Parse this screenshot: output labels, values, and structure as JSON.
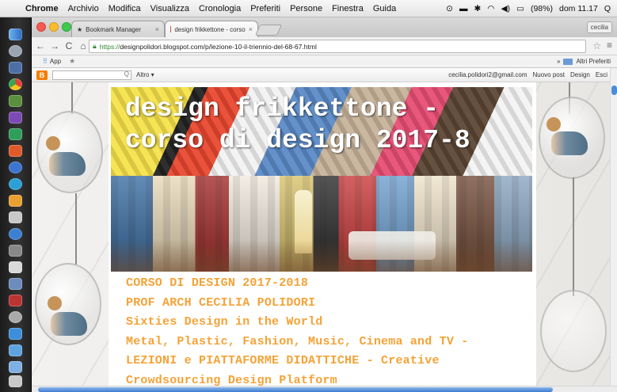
{
  "menubar": {
    "app": "Chrome",
    "items": [
      "Archivio",
      "Modifica",
      "Visualizza",
      "Cronologia",
      "Preferiti",
      "Persone",
      "Finestra",
      "Guida"
    ],
    "battery": "(98%)",
    "clock": "dom 11.17",
    "search_icon": "Q"
  },
  "tabs": [
    {
      "label": "Bookmark Manager",
      "active": false,
      "icon": "star-icon"
    },
    {
      "label": "design frikkettone - corso",
      "active": true,
      "icon": "blog-favicon"
    }
  ],
  "profile": "cecilia",
  "toolbar": {
    "url_scheme": "https://",
    "url_rest": "designpolidori.blogspot.com/p/lezione-10-il-triennio-del-68-67.html"
  },
  "bookmarks": {
    "apps": "App",
    "other": "Altri Preferiti"
  },
  "blogger_bar": {
    "altro": "Altro ▾",
    "email": "cecilia.polidori2@gmail.com",
    "new_post": "Nuovo post",
    "design": "Design",
    "logout": "Esci"
  },
  "blog": {
    "title_line1": "design frikkettone -",
    "title_line2": "corso di design 2017-8"
  },
  "post_lines": [
    "CORSO DI DESIGN 2017-2018",
    "PROF ARCH CECILIA POLIDORI",
    "Sixties Design in the World",
    "Metal, Plastic, Fashion, Music, Cinema and TV -",
    "LEZIONI  e  PIATTAFORME  DIDATTICHE  -  Creative",
    "Crowdsourcing Design Platform"
  ],
  "colors": {
    "post_text": "#f5a236",
    "url_secure": "#2e8b2e",
    "blogger": "#f57d00"
  }
}
